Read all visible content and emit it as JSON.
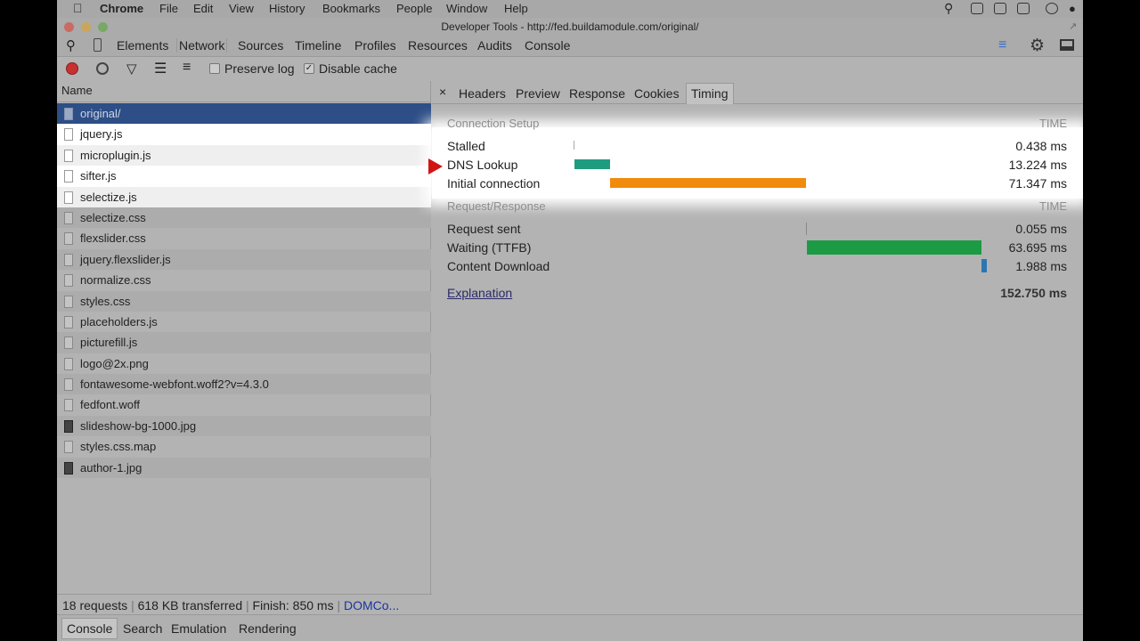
{
  "menubar": {
    "app": "Chrome",
    "items": [
      "File",
      "Edit",
      "View",
      "History",
      "Bookmarks",
      "People",
      "Window",
      "Help"
    ]
  },
  "window": {
    "title": "Developer Tools - http://fed.buildamodule.com/original/"
  },
  "panels": [
    "Elements",
    "Network",
    "Sources",
    "Timeline",
    "Profiles",
    "Resources",
    "Audits",
    "Console"
  ],
  "toolbar": {
    "preserve_log": "Preserve log",
    "disable_cache": "Disable cache",
    "preserve_checked": false,
    "disable_checked": true
  },
  "requests": {
    "header": "Name",
    "items": [
      "original/",
      "jquery.js",
      "microplugin.js",
      "sifter.js",
      "selectize.js",
      "selectize.css",
      "flexslider.css",
      "jquery.flexslider.js",
      "normalize.css",
      "styles.css",
      "placeholders.js",
      "picturefill.js",
      "logo@2x.png",
      "fontawesome-webfont.woff2?v=4.3.0",
      "fedfont.woff",
      "slideshow-bg-1000.jpg",
      "styles.css.map",
      "author-1.jpg"
    ],
    "selected": "original/"
  },
  "status": {
    "requests": "18 requests",
    "transferred": "618 KB transferred",
    "finish": "Finish: 850 ms",
    "dom": "DOMCo..."
  },
  "drawer_tabs": [
    "Console",
    "Search",
    "Emulation",
    "Rendering"
  ],
  "detail_tabs": [
    "Headers",
    "Preview",
    "Response",
    "Cookies",
    "Timing"
  ],
  "detail_close": "×",
  "timing": {
    "connection_setup": {
      "title": "Connection Setup",
      "time_header": "TIME",
      "rows": [
        {
          "label": "Stalled",
          "value": "0.438 ms",
          "color": "#aaaaaa"
        },
        {
          "label": "DNS Lookup",
          "value": "13.224 ms",
          "color": "#1f9c80"
        },
        {
          "label": "Initial connection",
          "value": "71.347 ms",
          "color": "#f18b0c"
        }
      ]
    },
    "request_response": {
      "title": "Request/Response",
      "time_header": "TIME",
      "rows": [
        {
          "label": "Request sent",
          "value": "0.055 ms",
          "color": "#888888"
        },
        {
          "label": "Waiting (TTFB)",
          "value": "63.695 ms",
          "color": "#1c9b44"
        },
        {
          "label": "Content Download",
          "value": "1.988 ms",
          "color": "#2a77b4"
        }
      ]
    },
    "explanation": "Explanation",
    "total": "152.750 ms"
  }
}
